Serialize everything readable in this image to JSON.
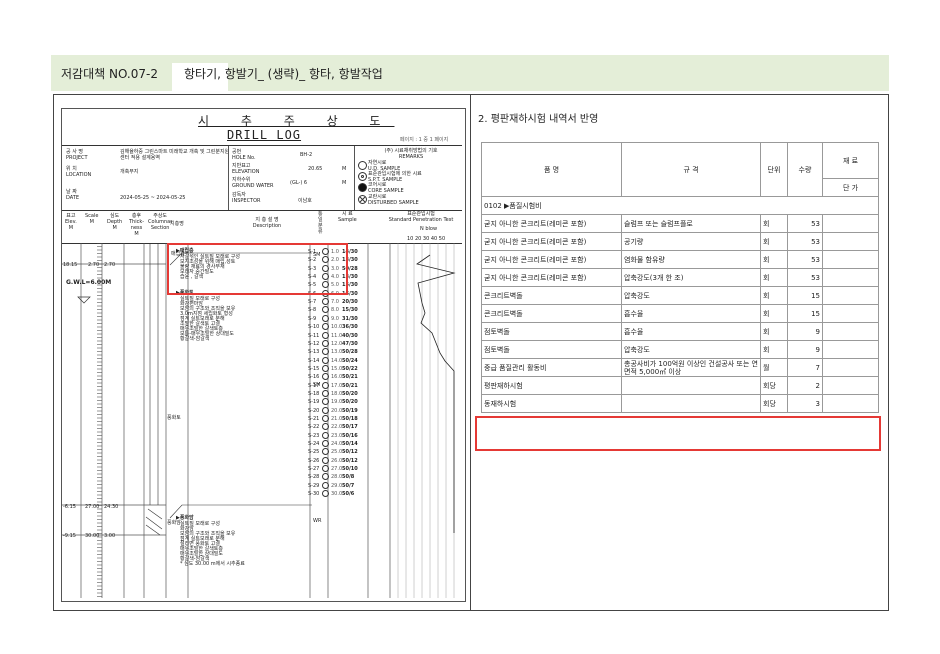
{
  "header": {
    "number": "저감대책 NO.07-2",
    "title": "항타기, 항발기_ (생략)_ 항타, 항발작업"
  },
  "log": {
    "title_ko": "시 추 주 상 도",
    "title_en": "DRILL LOG",
    "page_info": "페이지 : 1 중 1 페이지",
    "project_label": "공 사 명\nPROJECT",
    "project_value": "김해율하중 그린스마트 미래학교 개축 및 그린분지원 센터 적용 설계용역",
    "location_label": "위 치\nLOCATION",
    "location_value": "개축부지",
    "date_label": "날 짜\nDATE",
    "date_value": "2024-05-25 ~ 2024-05-25",
    "hole_label": "공번\nHOLE No.",
    "hole_value": "BH-2",
    "elev_label": "지반표고\nELEVATION",
    "elev_value": "20.65",
    "elev_unit": "M",
    "gw_label": "지하수위\nGROUND WATER",
    "gw_value": "(GL-)  6",
    "gw_unit": "M",
    "inspector_label": "감독자\nINSPECTOR",
    "inspector_value": "이남호",
    "legend_title": "(주) 시료채취방법의 기호\nREMARKS",
    "legend_items": [
      "자연시료\nU.D. SAMPLE",
      "표준관입시험에 의한 시료\nS.P.T. SAMPLE",
      "코어시료\nCORE SAMPLE",
      "교란시료\nDISTURBED SAMPLE"
    ],
    "col_elev": "표고\nElev.\nM",
    "col_scale": "Scale\nM",
    "col_depth": "심도\nDepth\nM",
    "col_thick": "층후\nThick-\nness\nM",
    "col_column": "주상도\nColumnar\nSection",
    "col_symbol": "지층명",
    "col_desc": "지 층 설 명\nDescription",
    "col_uscs": "통일분류",
    "col_sample": "시 료\nSample",
    "col_spt": "표준관입시험\nStandard Penetration Test",
    "col_n": "N  blow",
    "n_ticks": "10 20 30 40 50",
    "layers": [
      {
        "name": "매립층",
        "title": "▶매립층",
        "lines": [
          "자갈섞인 실트질 모래로 구성",
          "보지조성을 위해 매립,성토",
          "불량 재료의 경사부재",
          "모래자 중간밀도",
          "습윤 , 갈색"
        ],
        "elev": "18.15",
        "depth": "2.70",
        "thick": "2.70"
      },
      {
        "name": "풍화토",
        "title": "▶풍화토",
        "lines": [
          "실트질 모래로 구성",
          "화강편마암",
          "모암의 구조와 조직을 보유",
          "3.0m지점 세립화토 형성",
          "점계 실트모래로 분해",
          "조밀한 갈색토 고결",
          "매우조밀한 갈색토층",
          "보통-매우조밀한 상대밀도",
          "황갈색-암갈색"
        ],
        "uscs": "SM",
        "elev": "-6.15",
        "depth": "27.00",
        "thick": "24.30"
      },
      {
        "name": "풍화암",
        "title": "▶풍화암",
        "lines": [
          "실트질 모래로 구성",
          "화강암",
          "모암의 구조와 조직을 보유",
          "점계 실트모래로 분해",
          "절리면 풍화토 고결",
          "매우조밀한 갈색토층",
          "매우조밀한 상대밀도",
          "황갈색-암갈색",
          "* 심도 30.00 m에서 시추종료"
        ],
        "uscs": "WR",
        "elev": "-9.15",
        "depth": "30.00",
        "thick": "3.00"
      }
    ],
    "gw_mark": "G.W.L=6.00M",
    "samples": [
      "S-1",
      "S-2",
      "S-3",
      "S-4",
      "S-5",
      "S-6",
      "S-7",
      "S-8",
      "S-9",
      "S-10",
      "S-11",
      "S-12",
      "S-13",
      "S-14",
      "S-15",
      "S-16",
      "S-17",
      "S-18",
      "S-19",
      "S-20",
      "S-21",
      "S-22",
      "S-23",
      "S-24",
      "S-25",
      "S-26",
      "S-27",
      "S-28",
      "S-29",
      "S-30"
    ],
    "sample_depths": [
      "1.0",
      "2.0",
      "3.0",
      "4.0",
      "5.0",
      "6.0",
      "7.0",
      "8.0",
      "9.0",
      "10.0",
      "11.0",
      "12.0",
      "13.0",
      "14.0",
      "15.0",
      "16.0",
      "17.0",
      "18.0",
      "19.0",
      "20.0",
      "21.0",
      "22.0",
      "23.0",
      "24.0",
      "25.0",
      "26.0",
      "27.0",
      "28.0",
      "29.0",
      "30.0"
    ],
    "n_values": [
      "14/30",
      "13/30",
      "50/28",
      "13/30",
      "15/30",
      "16/30",
      "20/30",
      "15/30",
      "31/30",
      "36/30",
      "40/30",
      "47/30",
      "50/28",
      "50/24",
      "50/22",
      "50/21",
      "50/21",
      "50/20",
      "50/20",
      "50/19",
      "50/18",
      "50/17",
      "50/16",
      "50/14",
      "50/12",
      "50/12",
      "50/10",
      "50/8",
      "50/7",
      "50/6"
    ],
    "uscs_top": "SM"
  },
  "right": {
    "title": "2. 평판재하시험 내역서 반영",
    "col_name": "품 명",
    "col_spec": "규 격",
    "col_unit": "단위",
    "col_qty": "수량",
    "col_material": "재 료",
    "col_price": "단 가",
    "group": "0102 ▶품질시험비",
    "rows": [
      {
        "name": "굳지 아니한 콘크리트(레미콘 포함)",
        "spec": "슬럼프 또는 슬럼프플로",
        "unit": "회",
        "qty": "53"
      },
      {
        "name": "굳지 아니한 콘크리트(레미콘 포함)",
        "spec": "공기량",
        "unit": "회",
        "qty": "53"
      },
      {
        "name": "굳지 아니한 콘크리트(레미콘 포함)",
        "spec": "염화물 함유량",
        "unit": "회",
        "qty": "53"
      },
      {
        "name": "굳지 아니한 콘크리트(레미콘 포함)",
        "spec": "압축강도(3개 한 조)",
        "unit": "회",
        "qty": "53"
      },
      {
        "name": "콘크리트벽돌",
        "spec": "압축강도",
        "unit": "회",
        "qty": "15"
      },
      {
        "name": "콘크리트벽돌",
        "spec": "흡수율",
        "unit": "회",
        "qty": "15"
      },
      {
        "name": "점토벽돌",
        "spec": "흡수율",
        "unit": "회",
        "qty": "9"
      },
      {
        "name": "점토벽돌",
        "spec": "압축강도",
        "unit": "회",
        "qty": "9"
      },
      {
        "name": "중급 품질관리 활동비",
        "spec": "총공사비가 100억원 이상인 건설공사 또는 연면적 5,000㎡ 이상",
        "unit": "월",
        "qty": "7"
      },
      {
        "name": "평판재하시험",
        "spec": "",
        "unit": "회당",
        "qty": "2"
      },
      {
        "name": "동재하시험",
        "spec": "",
        "unit": "회당",
        "qty": "3"
      }
    ]
  }
}
